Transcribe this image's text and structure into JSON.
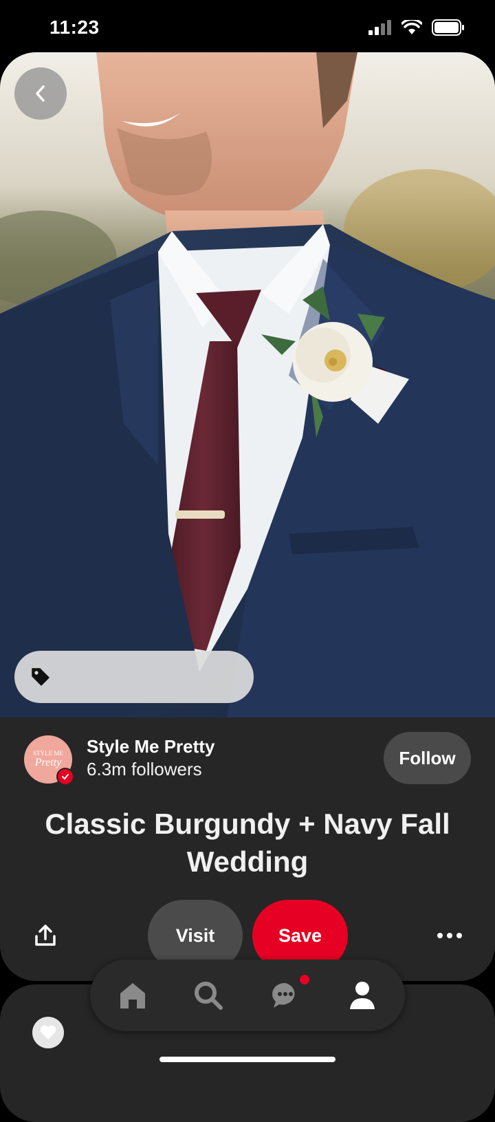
{
  "status_bar": {
    "time": "11:23"
  },
  "pin": {
    "creator": {
      "name": "Style Me Pretty",
      "followers": "6.3m followers",
      "avatar_text_top": "STYLE ME",
      "avatar_text_script": "Pretty",
      "verified": true
    },
    "follow_label": "Follow",
    "title": "Classic Burgundy + Navy Fall Wedding",
    "visit_label": "Visit",
    "save_label": "Save"
  },
  "icons": {
    "back": "chevron-left-icon",
    "tag": "tag-icon",
    "share": "share-icon",
    "more": "more-icon",
    "react": "heart-icon"
  },
  "nav": {
    "items": [
      "home",
      "search",
      "messages",
      "profile"
    ],
    "messages_has_notification": true
  },
  "colors": {
    "accent": "#e60023",
    "card_bg": "#262626",
    "button_bg": "#4a4a4a"
  }
}
